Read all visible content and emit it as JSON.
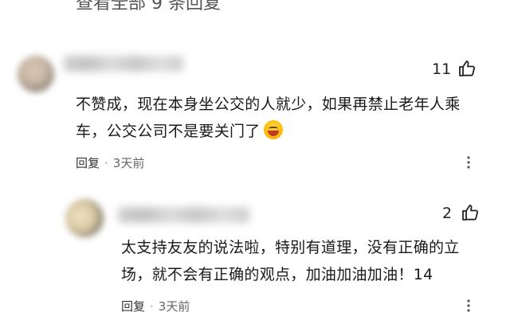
{
  "top_partial_text": "查看全部 9 条回复",
  "comments": [
    {
      "likes": "11",
      "text_lines": [
        "不赞成，现在本身坐公交的人就少，如果再禁止老年人乘",
        "车，公交公司不是要关门了"
      ],
      "emoji": "grinning-face-emoji",
      "reply_label": "回复",
      "separator": "·",
      "time": "3天前"
    },
    {
      "likes": "2",
      "text_lines": [
        "太支持友友的说法啦，特别有道理，没有正确的立",
        "场，就不会有正确的观点，加油加油加油！14"
      ],
      "reply_label": "回复",
      "separator": "·",
      "time": "3天前"
    }
  ],
  "icons": {
    "like": "thumbs-up-icon",
    "more": "more-icon"
  },
  "colors": {
    "text": "#1a1a1a",
    "meta": "#666666",
    "background": "#ffffff"
  }
}
